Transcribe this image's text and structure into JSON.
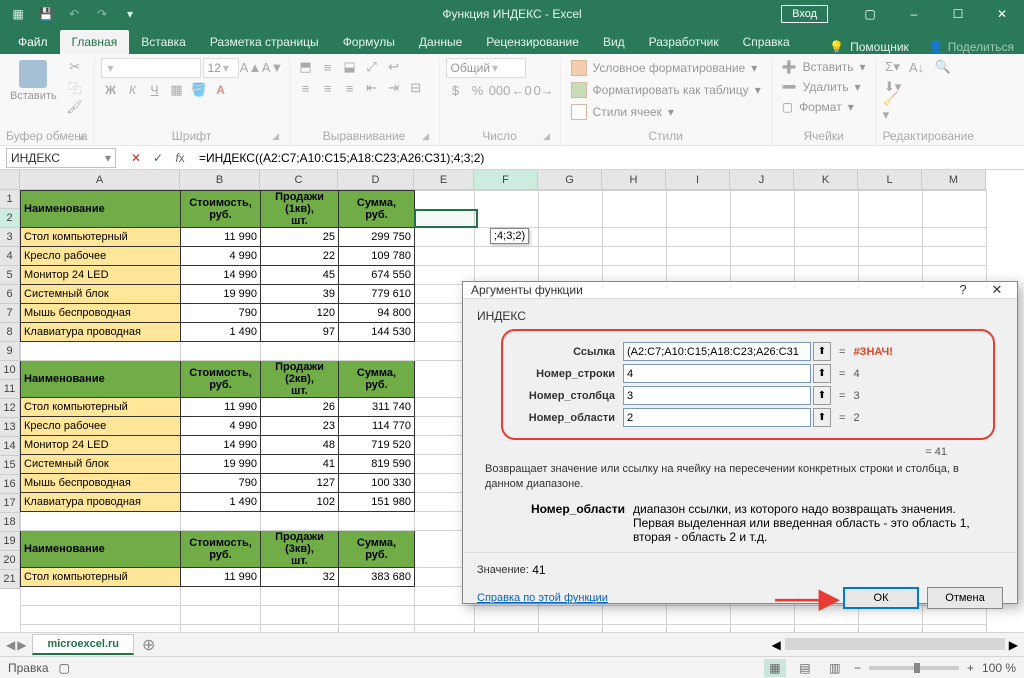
{
  "title": "Функция ИНДЕКС  -  Excel",
  "login": "Вход",
  "tabs": {
    "file": "Файл",
    "home": "Главная",
    "insert": "Вставка",
    "layout": "Разметка страницы",
    "formulas": "Формулы",
    "data": "Данные",
    "review": "Рецензирование",
    "view": "Вид",
    "dev": "Разработчик",
    "help": "Справка",
    "assist": "Помощник",
    "share": "Поделиться"
  },
  "ribbon": {
    "clipboard": {
      "paste": "Вставить",
      "group": "Буфер обмена"
    },
    "font": {
      "group": "Шрифт",
      "size": "12"
    },
    "align": {
      "group": "Выравнивание"
    },
    "number": {
      "group": "Число",
      "format": "Общий"
    },
    "styles": {
      "group": "Стили",
      "cond": "Условное форматирование",
      "table": "Форматировать как таблицу",
      "cell": "Стили ячеек"
    },
    "cells": {
      "group": "Ячейки",
      "insert": "Вставить",
      "delete": "Удалить",
      "format": "Формат"
    },
    "edit": {
      "group": "Редактирование"
    }
  },
  "namebox": "ИНДЕКС",
  "formula": "=ИНДЕКС((A2:C7;A10:C15;A18:C23;A26:C31);4;3;2)",
  "floating_edit": ";4;3;2)",
  "columns": [
    "A",
    "B",
    "C",
    "D",
    "E",
    "F",
    "G",
    "H",
    "I",
    "J",
    "K",
    "L",
    "M"
  ],
  "headers1": [
    "Наименование",
    "Стоимость, руб.",
    "Продажи (1кв), шт.",
    "Сумма, руб."
  ],
  "headers2": [
    "Наименование",
    "Стоимость, руб.",
    "Продажи (2кв), шт.",
    "Сумма, руб."
  ],
  "headers3": [
    "Наименование",
    "Стоимость, руб.",
    "Продажи (3кв), шт.",
    "Сумма, руб."
  ],
  "rows": [
    2,
    3,
    4,
    5,
    6,
    7,
    8,
    9,
    10,
    11,
    12,
    13,
    14,
    15,
    16,
    17,
    18
  ],
  "data1": [
    [
      "Стол компьютерный",
      "11 990",
      "25",
      "299 750"
    ],
    [
      "Кресло рабочее",
      "4 990",
      "22",
      "109 780"
    ],
    [
      "Монитор 24 LED",
      "14 990",
      "45",
      "674 550"
    ],
    [
      "Системный блок",
      "19 990",
      "39",
      "779 610"
    ],
    [
      "Мышь беспроводная",
      "790",
      "120",
      "94 800"
    ],
    [
      "Клавиатура проводная",
      "1 490",
      "97",
      "144 530"
    ]
  ],
  "data2": [
    [
      "Стол компьютерный",
      "11 990",
      "26",
      "311 740"
    ],
    [
      "Кресло рабочее",
      "4 990",
      "23",
      "114 770"
    ],
    [
      "Монитор 24 LED",
      "14 990",
      "48",
      "719 520"
    ],
    [
      "Системный блок",
      "19 990",
      "41",
      "819 590"
    ],
    [
      "Мышь беспроводная",
      "790",
      "127",
      "100 330"
    ],
    [
      "Клавиатура проводная",
      "1 490",
      "102",
      "151 980"
    ]
  ],
  "data3": [
    [
      "Стол компьютерный",
      "11 990",
      "32",
      "383 680"
    ]
  ],
  "sheet_tab": "microexcel.ru",
  "status": "Правка",
  "zoom": "100 %",
  "dialog": {
    "title": "Аргументы функции",
    "fn": "ИНДЕКС",
    "args": {
      "ref": {
        "label": "Ссылка",
        "value": "(A2:C7;A10:C15;A18:C23;A26:C31",
        "res": "#ЗНАЧ!"
      },
      "row": {
        "label": "Номер_строки",
        "value": "4",
        "res": "4"
      },
      "col": {
        "label": "Номер_столбца",
        "value": "3",
        "res": "3"
      },
      "area": {
        "label": "Номер_области",
        "value": "2",
        "res": "2"
      }
    },
    "result_inline": "=  41",
    "desc": "Возвращает значение или ссылку на ячейку на пересечении конкретных строки и столбца, в данном диапазоне.",
    "param_name": "Номер_области",
    "param_desc": "диапазон ссылки, из которого надо возвращать значения. Первая выделенная или введенная область - это область 1, вторая - область 2 и т.д.",
    "value_label": "Значение:",
    "value": "41",
    "help": "Справка по этой функции",
    "ok": "ОК",
    "cancel": "Отмена"
  },
  "chart_data": {
    "type": "table"
  }
}
